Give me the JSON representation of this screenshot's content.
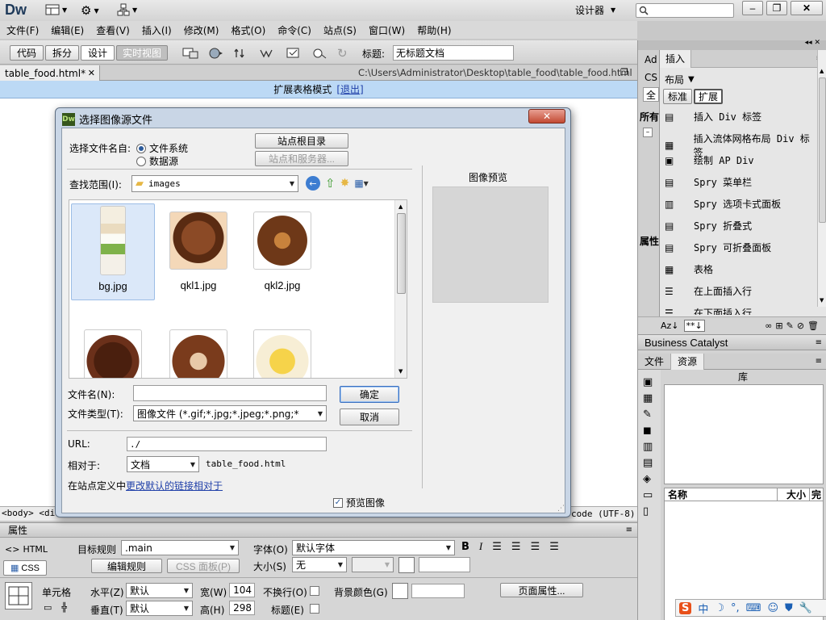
{
  "app": {
    "logo": "Dw",
    "workspace": "设计器",
    "search_placeholder": ""
  },
  "menu": [
    "文件(F)",
    "编辑(E)",
    "查看(V)",
    "插入(I)",
    "修改(M)",
    "格式(O)",
    "命令(C)",
    "站点(S)",
    "窗口(W)",
    "帮助(H)"
  ],
  "doc_toolbar": {
    "views": [
      "代码",
      "拆分",
      "设计",
      "实时视图"
    ],
    "title_label": "标题:",
    "title_value": "无标题文档"
  },
  "tab": {
    "name": "table_food.html*",
    "path": "C:\\Users\\Administrator\\Desktop\\table_food\\table_food.html"
  },
  "expanded_mode": {
    "text": "扩展表格模式",
    "exit": "[退出]"
  },
  "status": {
    "tags": "<body> <div",
    "encoding": "code (UTF-8)"
  },
  "dialog": {
    "title": "选择图像源文件",
    "select_from_label": "选择文件名自:",
    "radio_filesystem": "文件系统",
    "radio_datasource": "数据源",
    "site_root_button": "站点根目录",
    "site_server_button": "站点和服务器...",
    "lookin_label": "查找范围(I):",
    "lookin_value": "images",
    "preview_title": "图像预览",
    "files": [
      {
        "name": "bg.jpg"
      },
      {
        "name": "qkl1.jpg"
      },
      {
        "name": "qkl2.jpg"
      },
      {
        "name": ""
      },
      {
        "name": ""
      },
      {
        "name": ""
      }
    ],
    "filename_label": "文件名(N):",
    "filename_value": "",
    "filetype_label": "文件类型(T):",
    "filetype_value": "图像文件 (*.gif;*.jpg;*.jpeg;*.png;*",
    "ok_button": "确定",
    "cancel_button": "取消",
    "url_label": "URL:",
    "url_value": "./",
    "relative_label": "相对于:",
    "relative_value": "文档",
    "relative_file": "table_food.html",
    "site_def_text": "在站点定义中",
    "site_def_link": "更改默认的链接相对于",
    "preview_checkbox": "预览图像"
  },
  "props": {
    "title": "属性",
    "html_button": "HTML",
    "css_button": "CSS",
    "target_rule_label": "目标规则",
    "target_rule_value": ".main",
    "edit_rule_button": "编辑规则",
    "css_panel_button": "CSS 面板(P)",
    "font_label": "字体(O)",
    "font_value": "默认字体",
    "size_label": "大小(S)",
    "size_value": "无",
    "cell_label": "单元格",
    "horz_label": "水平(Z)",
    "horz_value": "默认",
    "vert_label": "垂直(T)",
    "vert_value": "默认",
    "width_label": "宽(W)",
    "width_value": "104",
    "height_label": "高(H)",
    "height_value": "298",
    "nowrap_label": "不换行(O)",
    "header_label": "标题(E)",
    "bgcolor_label": "背景颜色(G)",
    "page_props_button": "页面属性..."
  },
  "right_panel": {
    "insert_tab": "插入",
    "side_tabs": [
      "Ad",
      "CS",
      "全"
    ],
    "side_labels": [
      "所有",
      "属性"
    ],
    "category": "布局",
    "subtabs": [
      "标准",
      "扩展"
    ],
    "items": [
      "插入 Div 标签",
      "插入流体网格布局 Div 标签",
      "绘制 AP Div",
      "Spry 菜单栏",
      "Spry 选项卡式面板",
      "Spry 折叠式",
      "Spry 可折叠面板",
      "表格",
      "在上面插入行",
      "在下面插入行"
    ],
    "sort_label": "Az↓",
    "bc_title": "Business Catalyst",
    "files_tab": "文件",
    "assets_tab": "资源",
    "library_title": "库",
    "col_name": "名称",
    "col_size": "大小",
    "col_full": "完"
  },
  "colors": {
    "accent": "#bcd9f5",
    "link": "#1f3fa8",
    "ok_border": "#3a6fbf"
  }
}
